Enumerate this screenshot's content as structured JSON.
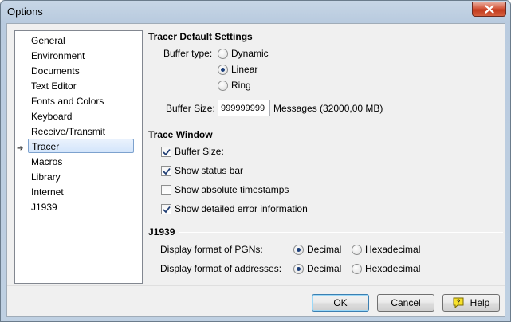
{
  "window": {
    "title": "Options"
  },
  "nav": {
    "items": [
      "General",
      "Environment",
      "Documents",
      "Text Editor",
      "Fonts and Colors",
      "Keyboard",
      "Receive/Transmit",
      "Tracer",
      "Macros",
      "Library",
      "Internet",
      "J1939"
    ],
    "selected": "Tracer"
  },
  "tracer_defaults": {
    "title": "Tracer Default Settings",
    "buffer_type_label": "Buffer type:",
    "buffer_type_options": [
      "Dynamic",
      "Linear",
      "Ring"
    ],
    "buffer_type_selected": "Linear",
    "buffer_size_label": "Buffer Size:",
    "buffer_size_value": "999999999",
    "buffer_size_unit": "Messages",
    "buffer_size_mb": "(32000,00 MB)"
  },
  "trace_window": {
    "title": "Trace Window",
    "options": [
      {
        "label": "Buffer Size:",
        "checked": true
      },
      {
        "label": "Show status bar",
        "checked": true
      },
      {
        "label": "Show absolute timestamps",
        "checked": false
      },
      {
        "label": "Show detailed error information",
        "checked": true
      }
    ]
  },
  "j1939": {
    "title": "J1939",
    "pgn_label": "Display format of PGNs:",
    "addr_label": "Display format of addresses:",
    "decimal": "Decimal",
    "hexadecimal": "Hexadecimal",
    "pgn_selected": "Decimal",
    "addr_selected": "Decimal"
  },
  "buttons": {
    "ok": "OK",
    "cancel": "Cancel",
    "help": "Help"
  },
  "colors": {
    "accent": "#3c7fb1",
    "close": "#c23a1d"
  }
}
